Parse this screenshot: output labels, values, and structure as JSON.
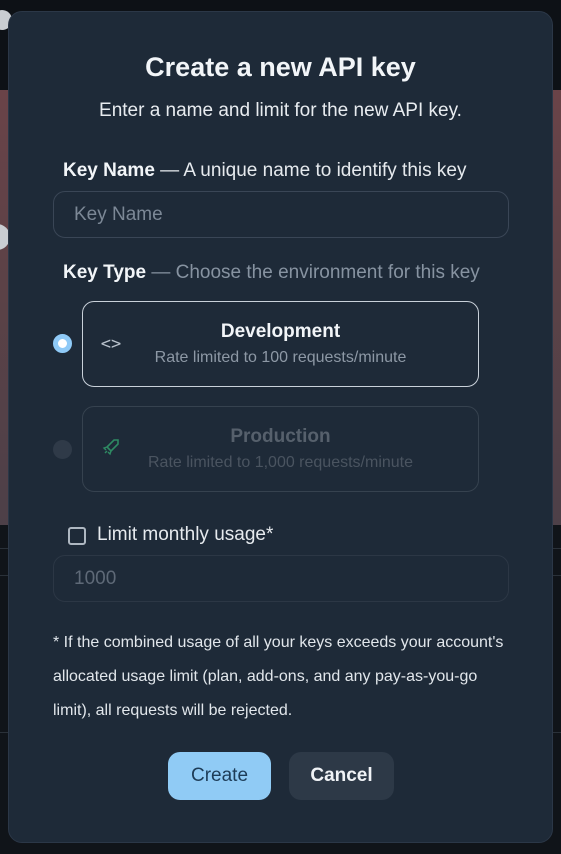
{
  "modal": {
    "title": "Create a new API key",
    "subtitle": "Enter a name and limit for the new API key.",
    "key_name": {
      "label": "Key Name",
      "hint": "— A unique name to identify this key",
      "placeholder": "Key Name",
      "value": ""
    },
    "key_type": {
      "label": "Key Type",
      "hint": "— Choose the environment for this key",
      "options": [
        {
          "title": "Development",
          "description": "Rate limited to 100 requests/minute",
          "icon": "code-brackets-icon",
          "selected": true,
          "enabled": true
        },
        {
          "title": "Production",
          "description": "Rate limited to 1,000 requests/minute",
          "icon": "rocket-icon",
          "selected": false,
          "enabled": false
        }
      ]
    },
    "limit": {
      "checkbox_label": "Limit monthly usage*",
      "checked": false,
      "placeholder": "1000"
    },
    "note": "* If the combined usage of all your keys exceeds your account's allocated usage limit (plan, add-ons, and any pay-as-you-go limit), all requests will be rejected.",
    "buttons": {
      "create": "Create",
      "cancel": "Cancel"
    },
    "colors": {
      "modal_bg": "#1e2a38",
      "accent": "#90cbf5",
      "rocket": "#2e8a63"
    }
  }
}
